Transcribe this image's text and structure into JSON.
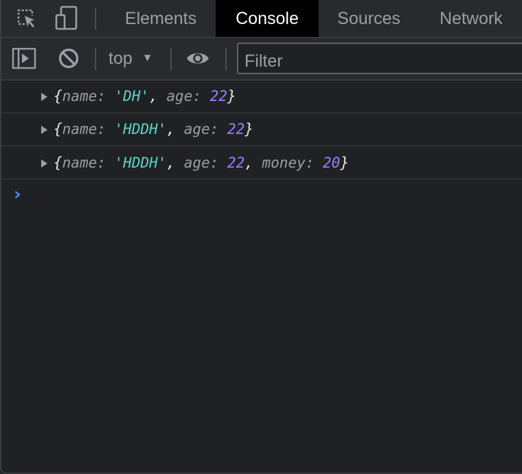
{
  "tabs": [
    {
      "label": "Elements",
      "active": false
    },
    {
      "label": "Console",
      "active": true
    },
    {
      "label": "Sources",
      "active": false
    },
    {
      "label": "Network",
      "active": false
    }
  ],
  "icons": {
    "inspect": "inspect-element-icon",
    "device": "device-toolbar-icon",
    "sidebar": "show-sidebar-icon",
    "clear": "clear-console-icon",
    "eye": "live-expression-icon",
    "dropdown": "caret-down-icon"
  },
  "toolbar": {
    "context": "top",
    "filter_placeholder": "Filter"
  },
  "log": [
    {
      "open": "{",
      "k1": "name",
      "v1": "'DH'",
      "k2": "age",
      "v2": "22",
      "close": "}"
    },
    {
      "open": "{",
      "k1": "name",
      "v1": "'HDDH'",
      "k2": "age",
      "v2": "22",
      "close": "}"
    },
    {
      "open": "{",
      "k1": "name",
      "v1": "'HDDH'",
      "k2": "age",
      "v2": "22",
      "k3": "money",
      "v3": "20",
      "close": "}"
    }
  ],
  "prompt_glyph": "›",
  "colors": {
    "background": "#202124",
    "string": "#5cd5c5",
    "number": "#9980ff",
    "prompt": "#4d8cf5"
  }
}
